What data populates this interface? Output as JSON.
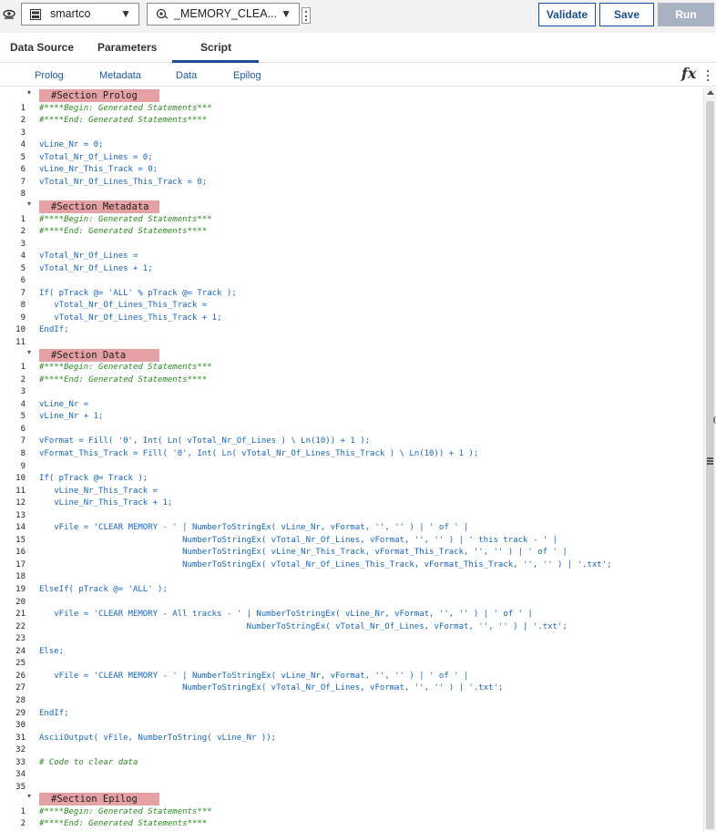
{
  "toolbar": {
    "server_dropdown": "smartco",
    "process_dropdown": "_MEMORY_CLEA...",
    "validate_label": "Validate",
    "save_label": "Save",
    "run_label": "Run"
  },
  "tabs": [
    "Data Source",
    "Parameters",
    "Script"
  ],
  "active_tab": "Script",
  "subtabs": [
    "Prolog",
    "Metadata",
    "Data",
    "Epilog"
  ],
  "fx_label": "fx",
  "colors": {
    "accent": "#1c4e96",
    "section_header": "#e6a1a4",
    "keyword": "#1565c0",
    "comment": "#2b8a1f",
    "string_function": "#d14b8f"
  },
  "icons": [
    "eye-pin-icon",
    "server-icon",
    "process-icon",
    "chevron-down-icon",
    "kebab-menu-icon",
    "fx-icon",
    "more-vertical-icon",
    "fold-icon",
    "scroll-up-icon",
    "splitter-grip-icon"
  ],
  "code_lines": [
    {
      "n": "",
      "type": "section",
      "text": "#Section Prolog",
      "fold": true
    },
    {
      "n": "1",
      "type": "comment",
      "text": "#****Begin: Generated Statements***"
    },
    {
      "n": "2",
      "type": "comment",
      "text": "#****End: Generated Statements****"
    },
    {
      "n": "3",
      "type": "code",
      "text": ""
    },
    {
      "n": "4",
      "type": "code",
      "text": "vLine_Nr = 0;"
    },
    {
      "n": "5",
      "type": "code",
      "text": "vTotal_Nr_Of_Lines = 0;"
    },
    {
      "n": "6",
      "type": "code",
      "text": "vLine_Nr_This_Track = 0;"
    },
    {
      "n": "7",
      "type": "code",
      "text": "vTotal_Nr_Of_Lines_This_Track = 0;"
    },
    {
      "n": "8",
      "type": "code",
      "text": ""
    },
    {
      "n": "",
      "type": "section",
      "text": "#Section Metadata",
      "fold": true
    },
    {
      "n": "1",
      "type": "comment",
      "text": "#****Begin: Generated Statements***"
    },
    {
      "n": "2",
      "type": "comment",
      "text": "#****End: Generated Statements****"
    },
    {
      "n": "3",
      "type": "code",
      "text": ""
    },
    {
      "n": "4",
      "type": "code",
      "text": "vTotal_Nr_Of_Lines ="
    },
    {
      "n": "5",
      "type": "code",
      "text": "vTotal_Nr_Of_Lines + 1;"
    },
    {
      "n": "6",
      "type": "code",
      "text": ""
    },
    {
      "n": "7",
      "type": "code",
      "text": "If( pTrack @= 'ALL' % pTrack @= Track );"
    },
    {
      "n": "8",
      "type": "code",
      "text": "   vTotal_Nr_Of_Lines_This_Track ="
    },
    {
      "n": "9",
      "type": "code",
      "text": "   vTotal_Nr_Of_Lines_This_Track + 1;"
    },
    {
      "n": "10",
      "type": "code",
      "text": "EndIf;"
    },
    {
      "n": "11",
      "type": "code",
      "text": ""
    },
    {
      "n": "",
      "type": "section",
      "text": "#Section Data",
      "fold": true
    },
    {
      "n": "1",
      "type": "comment",
      "text": "#****Begin: Generated Statements***"
    },
    {
      "n": "2",
      "type": "comment",
      "text": "#****End: Generated Statements****"
    },
    {
      "n": "3",
      "type": "code",
      "text": ""
    },
    {
      "n": "4",
      "type": "code",
      "text": "vLine_Nr ="
    },
    {
      "n": "5",
      "type": "code",
      "text": "vLine_Nr + 1;"
    },
    {
      "n": "6",
      "type": "code",
      "text": ""
    },
    {
      "n": "7",
      "type": "code",
      "text": "vFormat = Fill( '0', Int( Ln( vTotal_Nr_Of_Lines ) \\ Ln(10)) + 1 );"
    },
    {
      "n": "8",
      "type": "code",
      "text": "vFormat_This_Track = Fill( '0', Int( Ln( vTotal_Nr_Of_Lines_This_Track ) \\ Ln(10)) + 1 );"
    },
    {
      "n": "9",
      "type": "code",
      "text": ""
    },
    {
      "n": "10",
      "type": "code",
      "text": "If( pTrack @= Track );"
    },
    {
      "n": "11",
      "type": "code",
      "text": "   vLine_Nr_This_Track ="
    },
    {
      "n": "12",
      "type": "code",
      "text": "   vLine_Nr_This_Track + 1;"
    },
    {
      "n": "13",
      "type": "code",
      "text": ""
    },
    {
      "n": "14",
      "type": "code",
      "text": "   vFile = 'CLEAR MEMORY - ' | NumberToStringEx( vLine_Nr, vFormat, '', '' ) | ' of ' |"
    },
    {
      "n": "15",
      "type": "code",
      "text": "                             NumberToStringEx( vTotal_Nr_Of_Lines, vFormat, '', '' ) | ' this track - ' |"
    },
    {
      "n": "16",
      "type": "code",
      "text": "                             NumberToStringEx( vLine_Nr_This_Track, vFormat_This_Track, '', '' ) | ' of ' |"
    },
    {
      "n": "17",
      "type": "code",
      "text": "                             NumberToStringEx( vTotal_Nr_Of_Lines_This_Track, vFormat_This_Track, '', '' ) | '.txt';"
    },
    {
      "n": "18",
      "type": "code",
      "text": ""
    },
    {
      "n": "19",
      "type": "code",
      "text": "ElseIf( pTrack @= 'ALL' );"
    },
    {
      "n": "20",
      "type": "code",
      "text": ""
    },
    {
      "n": "21",
      "type": "code",
      "text": "   vFile = 'CLEAR MEMORY - All tracks - ' | NumberToStringEx( vLine_Nr, vFormat, '', '' ) | ' of ' |"
    },
    {
      "n": "22",
      "type": "code",
      "text": "                                          NumberToStringEx( vTotal_Nr_Of_Lines, vFormat, '', '' ) | '.txt';"
    },
    {
      "n": "23",
      "type": "code",
      "text": ""
    },
    {
      "n": "24",
      "type": "code",
      "text": "Else;"
    },
    {
      "n": "25",
      "type": "code",
      "text": ""
    },
    {
      "n": "26",
      "type": "code",
      "text": "   vFile = 'CLEAR MEMORY - ' | NumberToStringEx( vLine_Nr, vFormat, '', '' ) | ' of ' |"
    },
    {
      "n": "27",
      "type": "code",
      "text": "                             NumberToStringEx( vTotal_Nr_Of_Lines, vFormat, '', '' ) | '.txt';"
    },
    {
      "n": "28",
      "type": "code",
      "text": ""
    },
    {
      "n": "29",
      "type": "code",
      "text": "EndIf;"
    },
    {
      "n": "30",
      "type": "code",
      "text": ""
    },
    {
      "n": "31",
      "type": "code",
      "text": "AsciiOutput( vFile, NumberToString( vLine_Nr ));"
    },
    {
      "n": "32",
      "type": "code",
      "text": ""
    },
    {
      "n": "33",
      "type": "comment",
      "text": "# Code to clear data"
    },
    {
      "n": "34",
      "type": "code",
      "text": ""
    },
    {
      "n": "35",
      "type": "code",
      "text": ""
    },
    {
      "n": "",
      "type": "section",
      "text": "#Section Epilog",
      "fold": true
    },
    {
      "n": "1",
      "type": "comment",
      "text": "#****Begin: Generated Statements***"
    },
    {
      "n": "2",
      "type": "comment",
      "text": "#****End: Generated Statements****"
    }
  ]
}
